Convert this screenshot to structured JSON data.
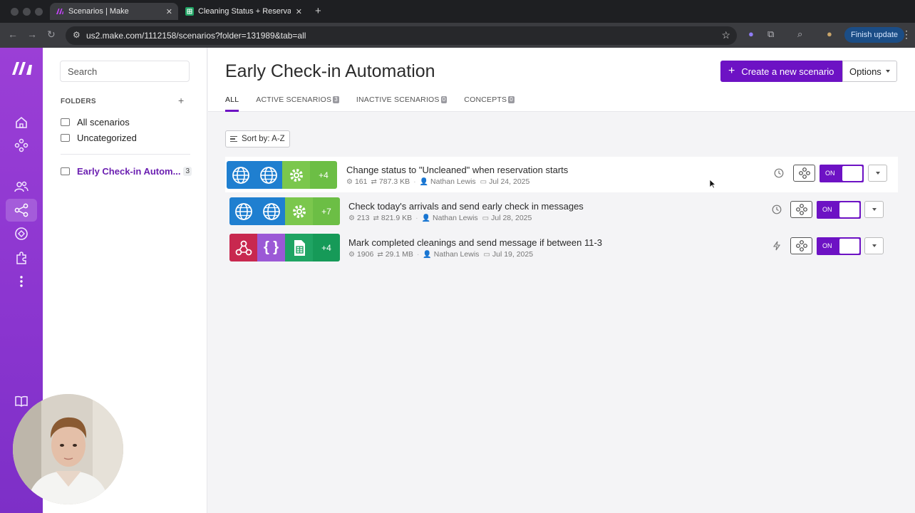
{
  "browser": {
    "tabs": [
      {
        "title": "Scenarios | Make",
        "active": true
      },
      {
        "title": "Cleaning Status + Reservation",
        "active": false
      }
    ],
    "url": "us2.make.com/1112158/scenarios?folder=131989&tab=all",
    "finish_update_label": "Finish update"
  },
  "sidebar": {
    "search_placeholder": "Search",
    "folders_header": "FOLDERS",
    "items": [
      {
        "label": "All scenarios"
      },
      {
        "label": "Uncategorized"
      },
      {
        "label": "Early Check-in Autom...",
        "count": "3",
        "selected": true
      }
    ]
  },
  "header": {
    "title": "Early Check-in Automation",
    "create_label": "Create a new scenario",
    "options_label": "Options",
    "tabs": [
      {
        "label": "ALL",
        "active": true
      },
      {
        "label": "ACTIVE SCENARIOS",
        "badge": "3"
      },
      {
        "label": "INACTIVE SCENARIOS",
        "badge": "0"
      },
      {
        "label": "CONCEPTS",
        "badge": "0"
      }
    ]
  },
  "sort_label": "Sort by: A-Z",
  "scenarios": [
    {
      "title": "Change status to \"Uncleaned\" when reservation starts",
      "operations": "161",
      "data": "787.3 KB",
      "author": "Nathan Lewis",
      "date": "Jul 24, 2025",
      "more": "+4",
      "toggle": "ON",
      "schedule_icon": "clock-icon"
    },
    {
      "title": "Check today's arrivals and send early check in messages",
      "operations": "213",
      "data": "821.9 KB",
      "author": "Nathan Lewis",
      "date": "Jul 28, 2025",
      "more": "+7",
      "toggle": "ON",
      "schedule_icon": "clock-icon"
    },
    {
      "title": "Mark completed cleanings and send message if between 11-3",
      "operations": "1906",
      "data": "29.1 MB",
      "author": "Nathan Lewis",
      "date": "Jul 19, 2025",
      "more": "+4",
      "toggle": "ON",
      "schedule_icon": "lightning-icon"
    }
  ],
  "colors": {
    "brand_purple": "#6d12c4",
    "rail_purple": "#9b3fd6",
    "http_blue": "#1f7fd0",
    "tools_green": "#7bc74d",
    "webhook_red": "#c8284f",
    "json_purple": "#9b59d6",
    "sheets_green": "#1fa463"
  }
}
